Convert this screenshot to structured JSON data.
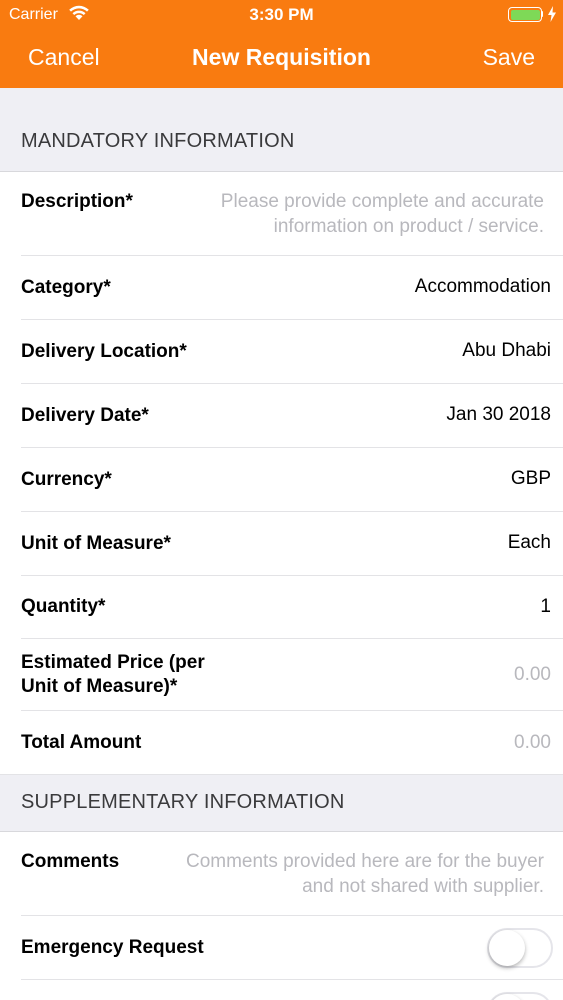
{
  "status_bar": {
    "carrier": "Carrier",
    "time": "3:30 PM",
    "battery_color": "#7ed957"
  },
  "nav": {
    "cancel": "Cancel",
    "title": "New Requisition",
    "save": "Save",
    "background": "#f97b10"
  },
  "mandatory": {
    "header": "MANDATORY INFORMATION",
    "description": {
      "label": "Description*",
      "placeholder_line1": "Please provide complete and accurate",
      "placeholder_line2": "information on product / service."
    },
    "category": {
      "label": "Category*",
      "value": "Accommodation"
    },
    "delivery_location": {
      "label": "Delivery Location*",
      "value": "Abu Dhabi"
    },
    "delivery_date": {
      "label": "Delivery Date*",
      "value": "Jan 30 2018"
    },
    "currency": {
      "label": "Currency*",
      "value": "GBP"
    },
    "unit_of_measure": {
      "label": "Unit of Measure*",
      "value": "Each"
    },
    "quantity": {
      "label": "Quantity*",
      "value": "1"
    },
    "estimated_price": {
      "label_line1": "Estimated Price (per",
      "label_line2": "Unit of Measure)*",
      "value": "0.00"
    },
    "total_amount": {
      "label": "Total Amount",
      "value": "0.00"
    }
  },
  "supplementary": {
    "header": "SUPPLEMENTARY INFORMATION",
    "comments": {
      "label": "Comments",
      "placeholder_line1": "Comments provided here are for the buyer",
      "placeholder_line2": "and not shared with supplier."
    },
    "emergency_request": {
      "label": "Emergency Request",
      "enabled": false
    }
  }
}
